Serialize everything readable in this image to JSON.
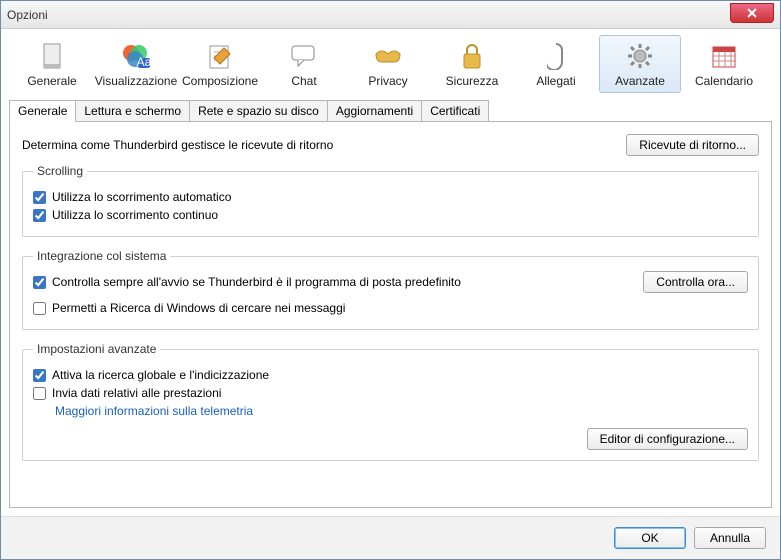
{
  "window": {
    "title": "Opzioni"
  },
  "toolbar": [
    {
      "id": "generale",
      "label": "Generale"
    },
    {
      "id": "visualizzazione",
      "label": "Visualizzazione"
    },
    {
      "id": "composizione",
      "label": "Composizione"
    },
    {
      "id": "chat",
      "label": "Chat"
    },
    {
      "id": "privacy",
      "label": "Privacy"
    },
    {
      "id": "sicurezza",
      "label": "Sicurezza"
    },
    {
      "id": "allegati",
      "label": "Allegati"
    },
    {
      "id": "avanzate",
      "label": "Avanzate",
      "active": true
    },
    {
      "id": "calendario",
      "label": "Calendario"
    }
  ],
  "tabs": [
    {
      "label": "Generale",
      "active": true
    },
    {
      "label": "Lettura e schermo"
    },
    {
      "label": "Rete e spazio su disco"
    },
    {
      "label": "Aggiornamenti"
    },
    {
      "label": "Certificati"
    }
  ],
  "intro": {
    "text": "Determina come Thunderbird gestisce le ricevute di ritorno",
    "button": "Ricevute di ritorno..."
  },
  "scrolling": {
    "legend": "Scrolling",
    "auto": {
      "label": "Utilizza lo scorrimento automatico",
      "checked": true
    },
    "smooth": {
      "label": "Utilizza lo scorrimento continuo",
      "checked": true
    }
  },
  "system": {
    "legend": "Integrazione col sistema",
    "default": {
      "label": "Controlla sempre all'avvio se Thunderbird è il programma di posta predefinito",
      "checked": true
    },
    "button": "Controlla ora...",
    "search": {
      "label": "Permetti a Ricerca di Windows di cercare nei messaggi",
      "checked": false
    }
  },
  "advanced": {
    "legend": "Impostazioni avanzate",
    "gloda": {
      "label": "Attiva la ricerca globale e l'indicizzazione",
      "checked": true
    },
    "telemetry": {
      "label": "Invia dati relativi alle prestazioni",
      "checked": false
    },
    "link": "Maggiori informazioni sulla telemetria",
    "editor": "Editor di configurazione..."
  },
  "footer": {
    "ok": "OK",
    "cancel": "Annulla"
  }
}
